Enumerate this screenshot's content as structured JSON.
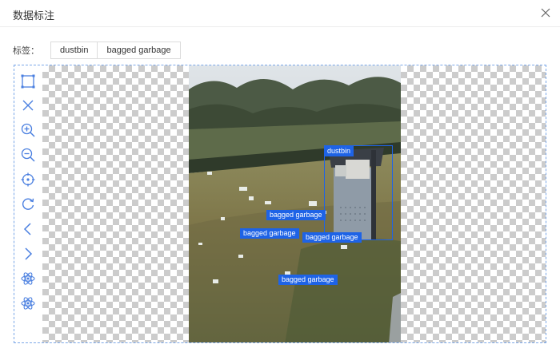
{
  "dialog": {
    "title": "数据标注"
  },
  "labels": {
    "title": "标签：",
    "options": [
      "dustbin",
      "bagged garbage"
    ]
  },
  "toolbar": {
    "tools": [
      "rectangle-icon",
      "delete-icon",
      "zoom-in-icon",
      "zoom-out-icon",
      "locate-icon",
      "rotate-icon",
      "prev-icon",
      "next-icon",
      "atom-icon",
      "atom-icon"
    ]
  },
  "annotations": [
    {
      "label": "dustbin"
    },
    {
      "label": "bagged garbage"
    },
    {
      "label": "bagged garbage"
    },
    {
      "label": "bagged garbage"
    },
    {
      "label": "bagged garbage"
    }
  ],
  "colors": {
    "accent": "#1e63e6",
    "frame": "#7aa6e8"
  }
}
